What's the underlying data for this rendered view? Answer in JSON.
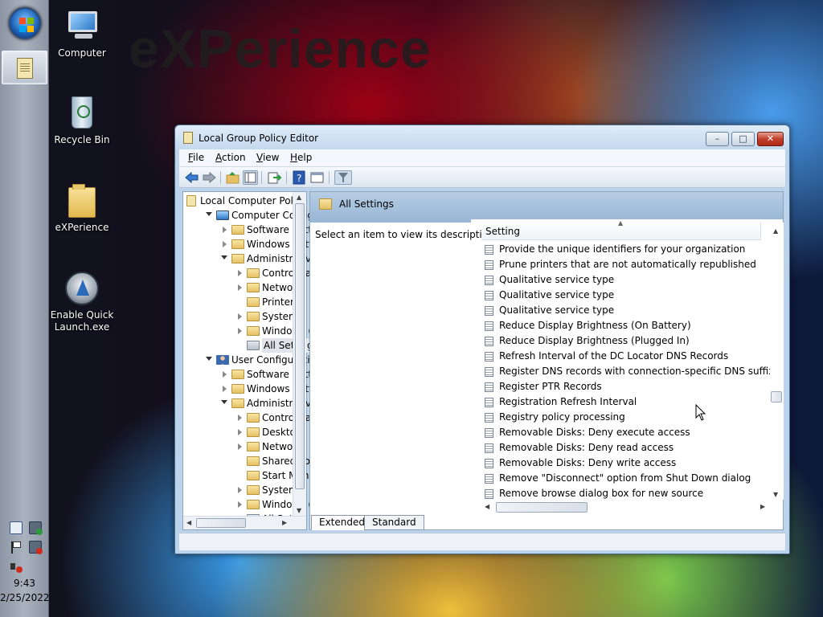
{
  "desktop": {
    "watermark": "eXPerience",
    "icons": [
      {
        "label": "Computer",
        "icon": "computer-icon"
      },
      {
        "label": "Recycle Bin",
        "icon": "recycle-bin-icon"
      },
      {
        "label": "eXPerience",
        "icon": "folder-icon"
      },
      {
        "label": "Enable Quick Launch.exe",
        "icon": "quick-launch-app-icon"
      }
    ]
  },
  "taskbar": {
    "start_icon": "windows-start-orb-icon",
    "active_app_icon": "group-policy-editor-icon",
    "time": "9:43",
    "date": "2/25/2022"
  },
  "window": {
    "title": "Local Group Policy Editor",
    "menu": [
      "File",
      "Action",
      "View",
      "Help"
    ],
    "menu_accel": [
      "F",
      "A",
      "V",
      "H"
    ],
    "tree": [
      {
        "label": "Local Computer Polic",
        "level": 0,
        "toggle": "none",
        "icon": "doc"
      },
      {
        "label": "Computer Config",
        "level": 1,
        "toggle": "open",
        "icon": "computer"
      },
      {
        "label": "Software Setti",
        "level": 2,
        "toggle": "closed",
        "icon": "folder"
      },
      {
        "label": "Windows Sett",
        "level": 2,
        "toggle": "closed",
        "icon": "folder"
      },
      {
        "label": "Administrative",
        "level": 2,
        "toggle": "open",
        "icon": "folder"
      },
      {
        "label": "Control Pa",
        "level": 3,
        "toggle": "closed",
        "icon": "folder"
      },
      {
        "label": "Network",
        "level": 3,
        "toggle": "closed",
        "icon": "folder"
      },
      {
        "label": "Printers",
        "level": 3,
        "toggle": "none",
        "icon": "folder"
      },
      {
        "label": "System",
        "level": 3,
        "toggle": "closed",
        "icon": "folder"
      },
      {
        "label": "Windows (",
        "level": 3,
        "toggle": "closed",
        "icon": "folder"
      },
      {
        "label": "All Setting",
        "level": 3,
        "toggle": "none",
        "icon": "settings",
        "selected": true
      },
      {
        "label": "User Configuration",
        "level": 1,
        "toggle": "open",
        "icon": "user"
      },
      {
        "label": "Software Setti",
        "level": 2,
        "toggle": "closed",
        "icon": "folder"
      },
      {
        "label": "Windows Sett",
        "level": 2,
        "toggle": "closed",
        "icon": "folder"
      },
      {
        "label": "Administrative",
        "level": 2,
        "toggle": "open",
        "icon": "folder"
      },
      {
        "label": "Control Pa",
        "level": 3,
        "toggle": "closed",
        "icon": "folder"
      },
      {
        "label": "Desktop",
        "level": 3,
        "toggle": "closed",
        "icon": "folder"
      },
      {
        "label": "Network",
        "level": 3,
        "toggle": "closed",
        "icon": "folder"
      },
      {
        "label": "Shared Fol",
        "level": 3,
        "toggle": "none",
        "icon": "folder"
      },
      {
        "label": "Start Menu",
        "level": 3,
        "toggle": "none",
        "icon": "folder"
      },
      {
        "label": "System",
        "level": 3,
        "toggle": "closed",
        "icon": "folder"
      },
      {
        "label": "Windows (",
        "level": 3,
        "toggle": "closed",
        "icon": "folder"
      },
      {
        "label": "All Setti",
        "level": 3,
        "toggle": "none",
        "icon": "settings"
      }
    ],
    "right_header": "All Settings",
    "description_hint": "Select an item to view its description.",
    "column_header": "Setting",
    "settings": [
      "Provide the unique identifiers for your organization",
      "Prune printers that are not automatically republished",
      "Qualitative service type",
      "Qualitative service type",
      "Qualitative service type",
      "Reduce Display Brightness (On Battery)",
      "Reduce Display Brightness (Plugged In)",
      "Refresh Interval of the DC Locator DNS Records",
      "Register DNS records with connection-specific DNS suffix",
      "Register PTR Records",
      "Registration Refresh Interval",
      "Registry policy processing",
      "Removable Disks: Deny execute access",
      "Removable Disks: Deny read access",
      "Removable Disks: Deny write access",
      "Remove \"Disconnect\" option from Shut Down dialog",
      "Remove browse dialog box for new source"
    ],
    "tabs": [
      {
        "label": "Extended",
        "active": true
      },
      {
        "label": "Standard",
        "active": false
      }
    ],
    "colors": {
      "title_bg": "#c4d8ee",
      "close_button": "#c0402a",
      "pane_header": "#9ab8d6"
    }
  }
}
